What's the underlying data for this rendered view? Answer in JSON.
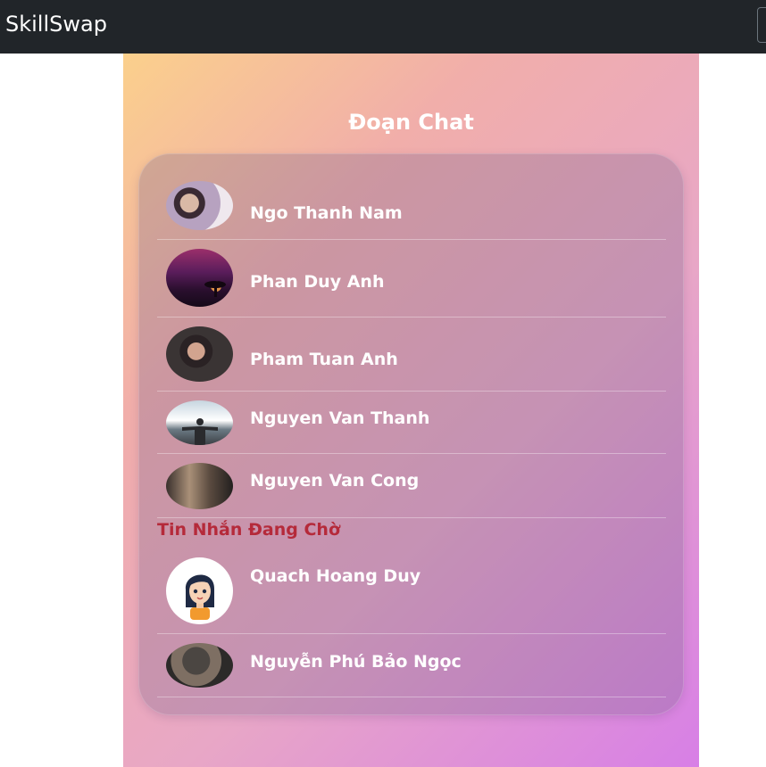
{
  "navbar": {
    "brand": "SkillSwap"
  },
  "chat": {
    "title": "Đoạn Chat",
    "contacts": [
      {
        "name": "Ngo Thanh Nam",
        "avatar": "portrait-photo"
      },
      {
        "name": "Phan Duy Anh",
        "avatar": "sunset-tree-photo"
      },
      {
        "name": "Pham Tuan Anh",
        "avatar": "portrait-photo"
      },
      {
        "name": "Nguyen Van Thanh",
        "avatar": "person-sky-photo"
      },
      {
        "name": "Nguyen Van Cong",
        "avatar": "people-outdoor-photo"
      }
    ],
    "pending_label": "Tin Nhắn Đang Chờ",
    "pending": [
      {
        "name": "Quach Hoang Duy",
        "avatar": "cartoon-girl-avatar"
      },
      {
        "name": "Nguyễn Phú Bảo Ngọc",
        "avatar": "camera-person-photo"
      }
    ]
  },
  "colors": {
    "navbar": "#212529",
    "panel_gradient": [
      "#fbd08c",
      "#f1aeaa",
      "#e8a7c6",
      "#d77fe6"
    ],
    "pending_label": "#b52a3a"
  }
}
